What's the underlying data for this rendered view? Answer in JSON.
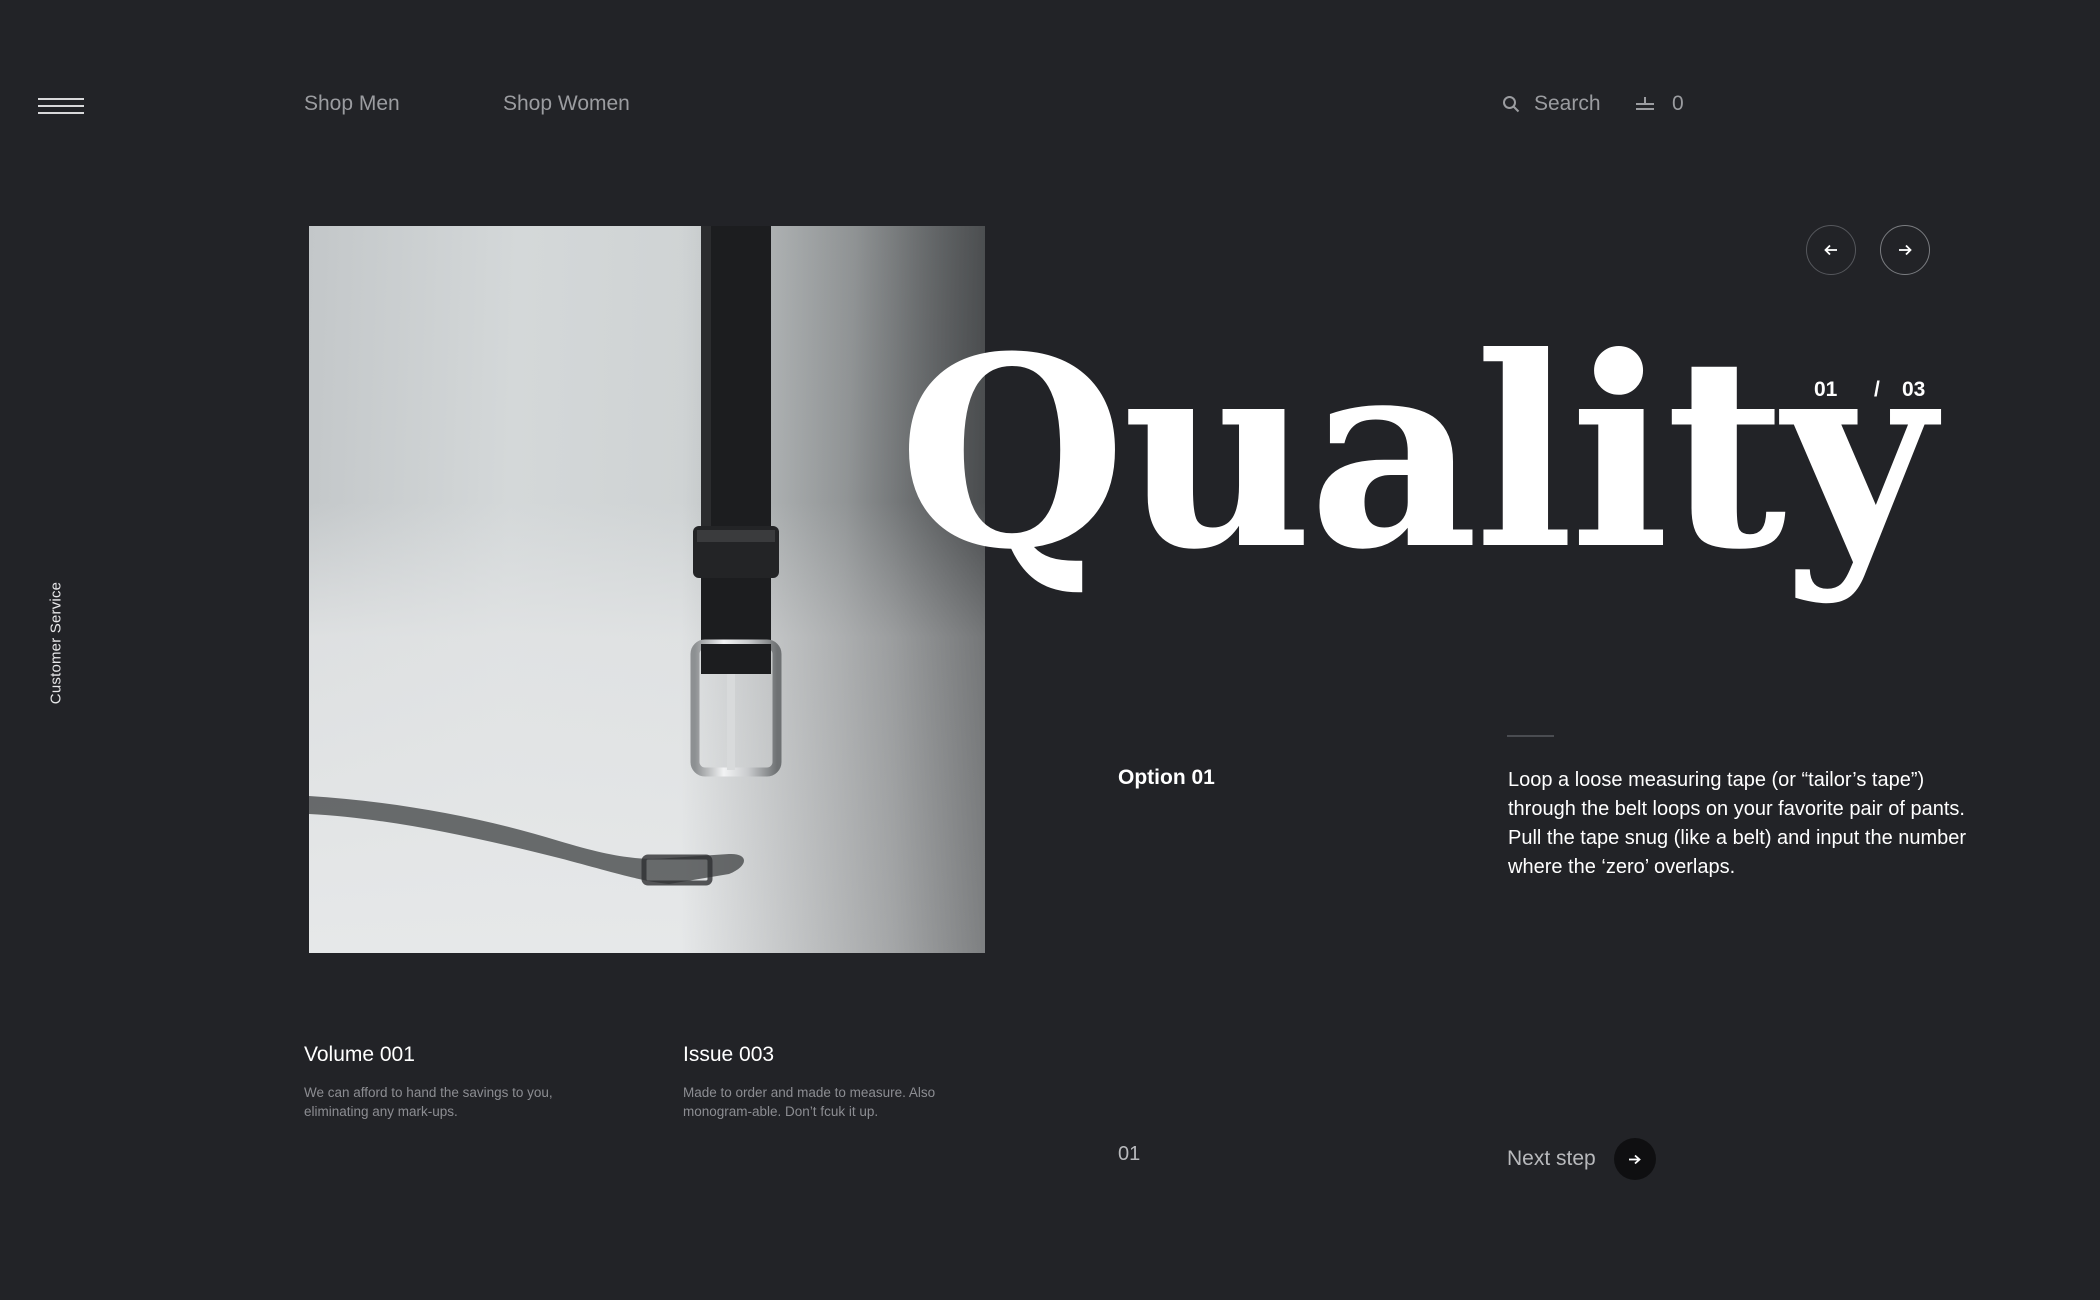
{
  "nav": {
    "shop_men": "Shop Men",
    "shop_women": "Shop Women",
    "search_label": "Search",
    "cart_count": "0",
    "customer_service": "Customer Service"
  },
  "hero": {
    "title": "Quality",
    "counter_current": "01",
    "counter_separator": "/",
    "counter_total": "03"
  },
  "option": {
    "label": "Option 01",
    "description": "Loop a loose measuring tape (or “tailor’s tape”) through the belt loops on your favorite pair of pants. Pull the tape snug (like a belt) and input the number where the ‘zero’ overlaps."
  },
  "info": {
    "volume_title": "Volume 001",
    "volume_text": "We can afford to hand the savings to you, eliminating any mark-ups.",
    "issue_title": "Issue 003",
    "issue_text": "Made to order and made to measure. Also monogram-able. Don’t fcuk it up."
  },
  "footer": {
    "step_number": "01",
    "next_step_label": "Next step"
  },
  "icons": {
    "menu": "hamburger-icon",
    "search": "search-icon",
    "cart": "cart-icon",
    "prev": "arrow-left-icon",
    "next": "arrow-right-icon"
  },
  "colors": {
    "background": "#222327",
    "text_primary": "#ffffff",
    "text_muted": "#9b9ca0"
  }
}
